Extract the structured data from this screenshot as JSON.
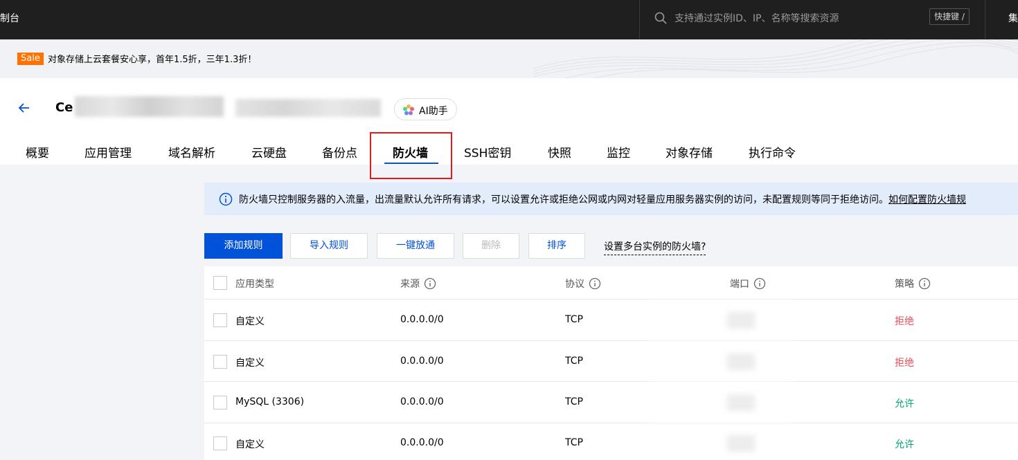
{
  "topbar": {
    "console_label": "制台",
    "search_placeholder": "支持通过实例ID、IP、名称等搜索资源",
    "shortcut_label": "快捷键 /",
    "more_label": "集"
  },
  "promo": {
    "badge": "Sale",
    "text": "对象存储上云套餐安心享，首年1.5折，三年1.3折！"
  },
  "header": {
    "instance_name": "Ce",
    "ai_label": "AI助手"
  },
  "tabs": [
    "概要",
    "应用管理",
    "域名解析",
    "云硬盘",
    "备份点",
    "防火墙",
    "SSH密钥",
    "快照",
    "监控",
    "对象存储",
    "执行命令"
  ],
  "active_tab": "防火墙",
  "info": {
    "text": "防火墙只控制服务器的入流量，出流量默认允许所有请求，可以设置允许或拒绝公网或内网对轻量应用服务器实例的访问，未配置规则等同于拒绝访问。",
    "link": "如何配置防火墙规"
  },
  "toolbar": {
    "add": "添加规则",
    "import": "导入规则",
    "allow_all": "一键放通",
    "delete": "删除",
    "sort": "排序",
    "multi_instance": "设置多台实例的防火墙?"
  },
  "table": {
    "headers": [
      "应用类型",
      "来源",
      "协议",
      "端口",
      "策略"
    ],
    "rows": [
      {
        "app": "自定义",
        "source": "0.0.0.0/0",
        "protocol": "TCP",
        "policy": "拒绝"
      },
      {
        "app": "自定义",
        "source": "0.0.0.0/0",
        "protocol": "TCP",
        "policy": "拒绝"
      },
      {
        "app": "MySQL (3306)",
        "source": "0.0.0.0/0",
        "protocol": "TCP",
        "policy": "允许"
      },
      {
        "app": "自定义",
        "source": "0.0.0.0/0",
        "protocol": "TCP",
        "policy": "允许"
      }
    ]
  },
  "colors": {
    "primary": "#0052d9",
    "deny": "#e34d59",
    "allow": "#00a870",
    "highlight": "#e61919"
  }
}
